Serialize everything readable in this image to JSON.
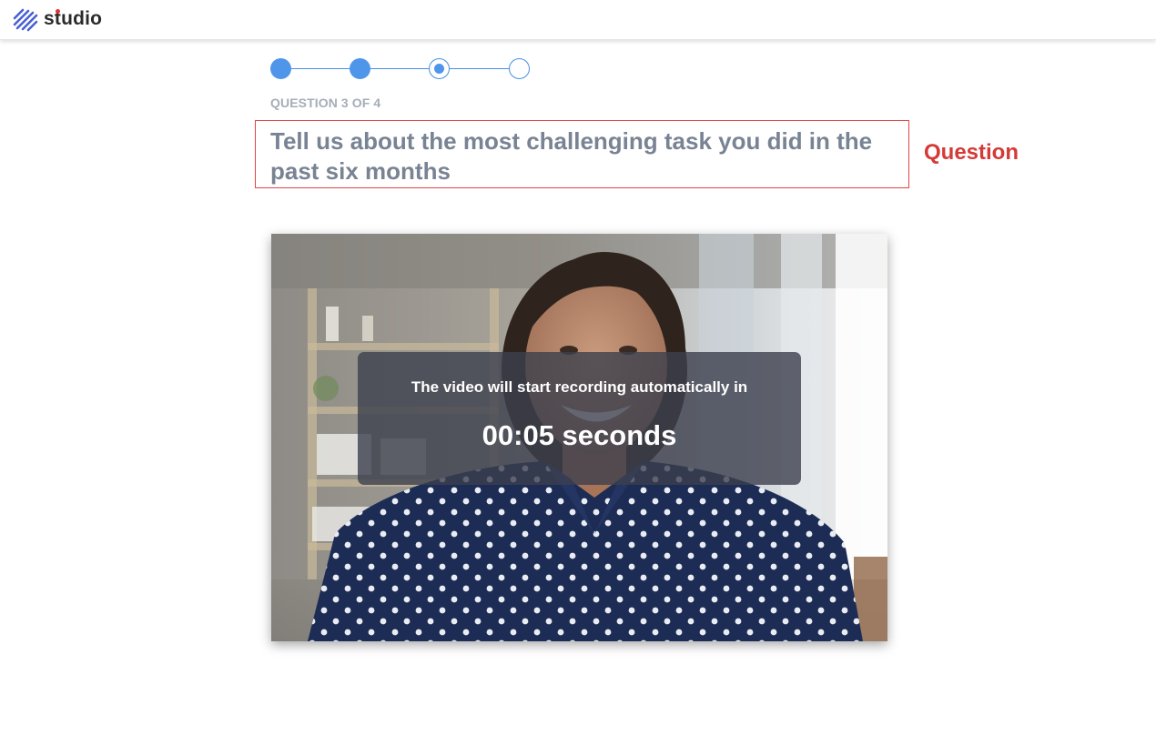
{
  "app": {
    "brand_name": "studio",
    "brand_color": "#4a5fd3",
    "brand_dot_color": "#e8302f"
  },
  "stepper": {
    "total": 4,
    "current": 3,
    "accent": "#4f96ea",
    "steps": [
      {
        "state": "done"
      },
      {
        "state": "done"
      },
      {
        "state": "current"
      },
      {
        "state": "todo"
      }
    ]
  },
  "question": {
    "counter": "QUESTION 3 OF 4",
    "text": "Tell us about the most challenging task you did in the past six months",
    "annotation": "Question",
    "annotation_color": "#d43a36"
  },
  "video": {
    "message": "The video will start recording automatically in",
    "countdown": "00:05 seconds"
  }
}
